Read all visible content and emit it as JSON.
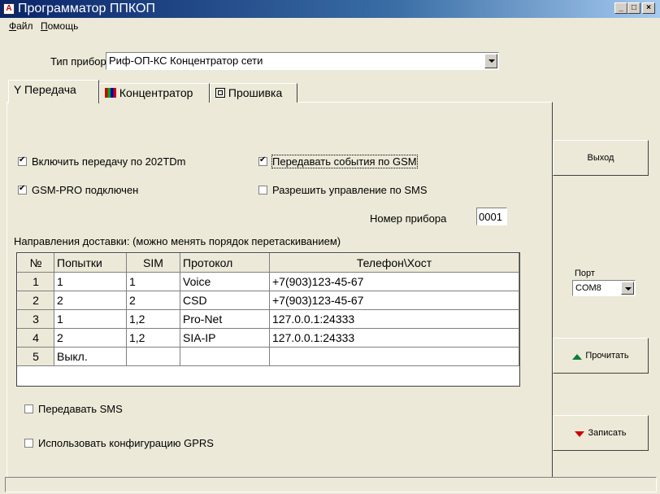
{
  "window": {
    "title": "Программатор ППКОП"
  },
  "menu": [
    "Файл",
    "Помощь"
  ],
  "device_type": {
    "label": "Тип прибора",
    "value": "Риф-ОП-КС Концентратор сети"
  },
  "tabs": [
    {
      "label": "Передача",
      "icon": "antenna-icon",
      "active": true
    },
    {
      "label": "Концентратор",
      "icon": "colored-bars-icon",
      "active": false
    },
    {
      "label": "Прошивка",
      "icon": "chip-icon",
      "active": false
    }
  ],
  "checkboxes": {
    "enable_202": {
      "label": "Включить передачу по 202TDm",
      "checked": true
    },
    "gsm_pro": {
      "label": "GSM-PRO подключен",
      "checked": true
    },
    "gsm_events": {
      "label": "Передавать события по GSM",
      "checked": true
    },
    "sms_control": {
      "label": "Разрешить управление по SMS",
      "checked": false
    },
    "send_sms": {
      "label": "Передавать SMS",
      "checked": false
    },
    "gprs_config": {
      "label": "Использовать конфигурацию GPRS",
      "checked": false
    }
  },
  "device_number": {
    "label": "Номер прибора",
    "value": "0001"
  },
  "delivery": {
    "caption": "Направления доставки: (можно менять порядок перетаскиванием)",
    "headers": [
      "№",
      "Попытки",
      "SIM",
      "Протокол",
      "Телефон\\Хост"
    ],
    "rows": [
      {
        "n": "1",
        "tries": "1",
        "sim": "1",
        "protocol": "Voice",
        "host": "+7(903)123-45-67"
      },
      {
        "n": "2",
        "tries": "2",
        "sim": "2",
        "protocol": "CSD",
        "host": "+7(903)123-45-67"
      },
      {
        "n": "3",
        "tries": "1",
        "sim": "1,2",
        "protocol": "Pro-Net",
        "host": "127.0.0.1:24333"
      },
      {
        "n": "4",
        "tries": "2",
        "sim": "1,2",
        "protocol": "SIA-IP",
        "host": "127.0.0.1:24333"
      },
      {
        "n": "5",
        "tries": "Выкл.",
        "sim": "",
        "protocol": "",
        "host": ""
      }
    ]
  },
  "side": {
    "exit_label": "Выход",
    "port_label": "Порт",
    "port_value": "COM8",
    "read_label": "Прочитать",
    "write_label": "Записать"
  }
}
